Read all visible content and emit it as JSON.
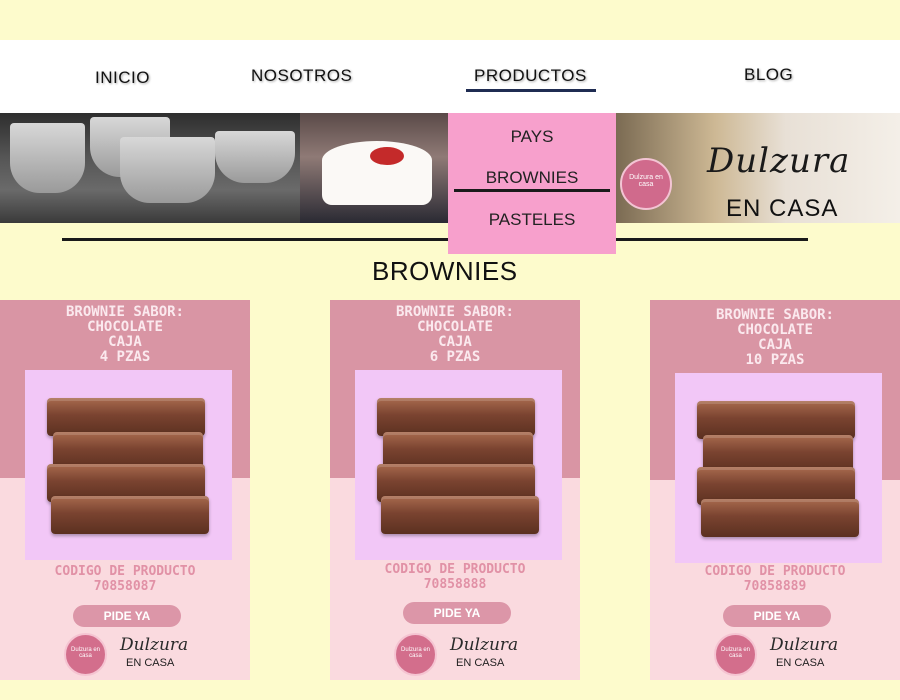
{
  "nav": {
    "inicio": "INICIO",
    "nosotros": "NOSOTROS",
    "productos": "PRODUCTOS",
    "blog": "BLOG"
  },
  "dropdown": {
    "pays": "PAYS",
    "brownies": "BROWNIES",
    "pasteles": "PASTELES"
  },
  "banner": {
    "badge_text": "Dulzura en casa",
    "logo_script": "Dulzura",
    "logo_sub": "EN CASA"
  },
  "section": {
    "title": "BROWNIES"
  },
  "products": [
    {
      "title": "BROWNIE SABOR:\nCHOCOLATE\nCAJA\n4 PZAS",
      "code_label": "CODIGO DE PRODUCTO",
      "code": "70858087",
      "button": "PIDE YA",
      "brand_script": "Dulzura",
      "brand_sub": "EN CASA",
      "badge_text": "Dulzura en casa"
    },
    {
      "title": "BROWNIE SABOR:\nCHOCOLATE\nCAJA\n6 PZAS",
      "code_label": "CODIGO DE PRODUCTO",
      "code": "70858888",
      "button": "PIDE YA",
      "brand_script": "Dulzura",
      "brand_sub": "EN CASA",
      "badge_text": "Dulzura en casa"
    },
    {
      "title": "BROWNIE SABOR:\nCHOCOLATE\nCAJA\n10 PZAS",
      "code_label": "CODIGO DE PRODUCTO",
      "code": "70858889",
      "button": "PIDE YA",
      "brand_script": "Dulzura",
      "brand_sub": "EN CASA",
      "badge_text": "Dulzura en casa"
    }
  ],
  "colors": {
    "background": "#fdfbcc",
    "dropdown": "#f7a0cc",
    "card_top": "#d995a4",
    "card_bottom": "#fadadf",
    "photo_bg": "#f2c7f7",
    "button": "#dc96a8",
    "nav_underline": "#1f2c52"
  }
}
